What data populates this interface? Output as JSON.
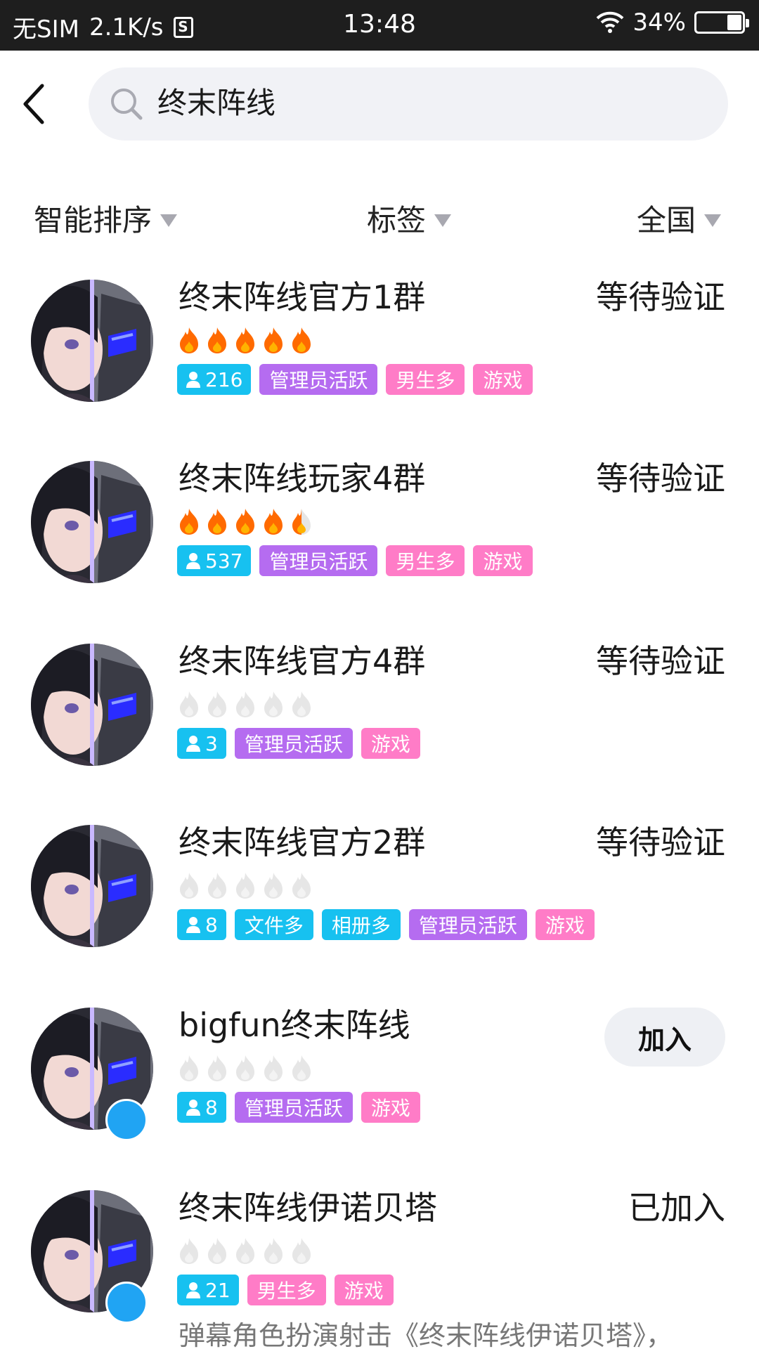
{
  "status_bar": {
    "carrier": "无SIM",
    "speed": "2.1K/s",
    "s_badge": "S",
    "time": "13:48",
    "battery": "34%",
    "battery_level": 0.34
  },
  "search": {
    "value": "终末阵线"
  },
  "filters": {
    "sort": "智能排序",
    "tag": "标签",
    "region": "全国"
  },
  "results": [
    {
      "name": "终末阵线官方1群",
      "status": "等待验证",
      "flames": 5,
      "count": "216",
      "tags": [
        "管理员活跃",
        "男生多",
        "游戏"
      ]
    },
    {
      "name": "终末阵线玩家4群",
      "status": "等待验证",
      "flames": 4.5,
      "count": "537",
      "tags": [
        "管理员活跃",
        "男生多",
        "游戏"
      ]
    },
    {
      "name": "终末阵线官方4群",
      "status": "等待验证",
      "flames": 0,
      "count": "3",
      "tags": [
        "管理员活跃",
        "游戏"
      ]
    },
    {
      "name": "终末阵线官方2群",
      "status": "等待验证",
      "flames": 0,
      "count": "8",
      "tags": [
        "文件多",
        "相册多",
        "管理员活跃",
        "游戏"
      ]
    },
    {
      "name": "bigfun终末阵线",
      "action": "加入",
      "flames": 0,
      "count": "8",
      "tags": [
        "管理员活跃",
        "游戏"
      ]
    },
    {
      "name": "终末阵线伊诺贝塔",
      "status": "已加入",
      "flames": 0,
      "count": "21",
      "tags": [
        "男生多",
        "游戏"
      ],
      "desc": "弹幕角色扮演射击《终末阵线伊诺贝塔》，"
    }
  ],
  "colors": {
    "tag_count": "#17c1f0",
    "tag_admin": "#b56cf0",
    "tag_pink": "#ff7cc7",
    "flame_active": "#ff6a00",
    "flame_inactive": "#e6e6e6"
  }
}
